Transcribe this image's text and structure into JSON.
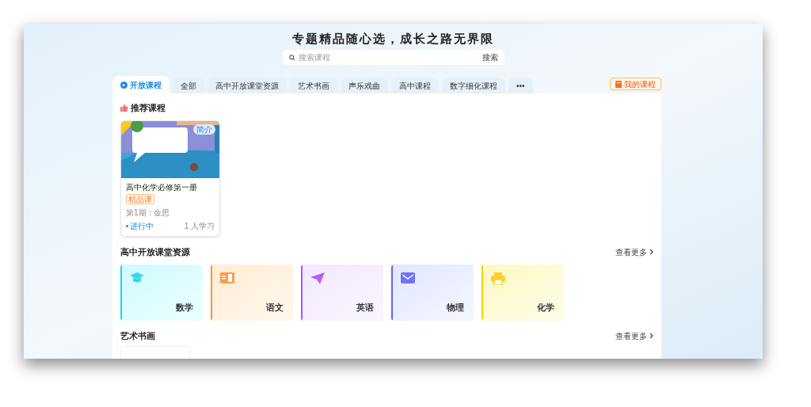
{
  "header": {
    "title": "专题精品随心选，成长之路无界限",
    "search": {
      "placeholder": "搜索课程",
      "button": "搜索"
    }
  },
  "tabs": [
    {
      "label": "开放课程",
      "selected": true,
      "kind": "logo"
    },
    {
      "label": "全部",
      "selected": false,
      "kind": "text"
    },
    {
      "label": "高中开放课堂资源",
      "selected": false,
      "kind": "text"
    },
    {
      "label": "艺术书画",
      "selected": false,
      "kind": "text"
    },
    {
      "label": "声乐戏曲",
      "selected": false,
      "kind": "text"
    },
    {
      "label": "高中课程",
      "selected": false,
      "kind": "text"
    },
    {
      "label": "数字细化课程",
      "selected": false,
      "kind": "text"
    },
    {
      "label": "•••",
      "selected": false,
      "kind": "text"
    }
  ],
  "my_courses": "我的课程",
  "sections": [
    {
      "kind": "courses",
      "title": "推荐课程",
      "courses": [
        {
          "intro": "简介",
          "name": "高中化学必修第一册",
          "tag": "精品课",
          "term": "第1期",
          "teacher": "金思",
          "status": "进行中",
          "learners": "1 人学习"
        }
      ]
    },
    {
      "kind": "subjects",
      "title": "高中开放课堂资源",
      "more": "查看更多",
      "subjects": [
        {
          "label": "数学",
          "kind": "cap",
          "color": "#22d3ee"
        },
        {
          "label": "语文",
          "kind": "book",
          "color": "#fb923c"
        },
        {
          "label": "英语",
          "kind": "plane",
          "color": "#a855f7"
        },
        {
          "label": "物理",
          "kind": "mail",
          "color": "#6366f1"
        },
        {
          "label": "化学",
          "kind": "printer",
          "color": "#facc15"
        }
      ]
    },
    {
      "kind": "partial",
      "title": "艺术书画",
      "more": "查看更多"
    }
  ]
}
